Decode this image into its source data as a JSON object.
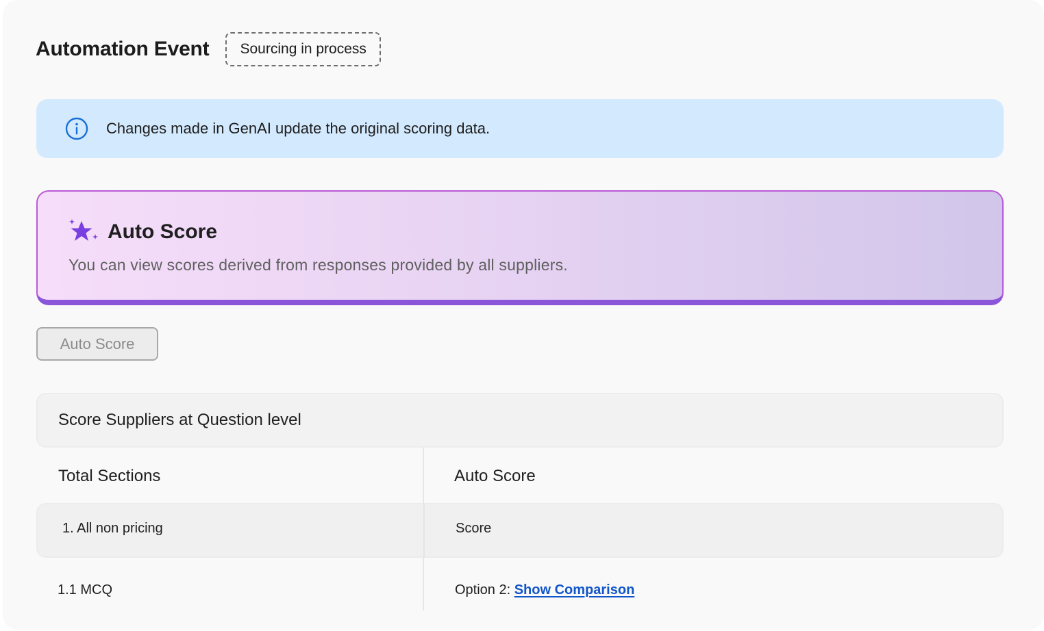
{
  "header": {
    "title": "Automation Event",
    "status": "Sourcing in process"
  },
  "info_banner": {
    "icon": "info-icon",
    "text": "Changes made in GenAI update the original scoring data."
  },
  "auto_score_card": {
    "icon": "sparkle-icon",
    "title": "Auto Score",
    "description": "You can view scores derived from responses provided by all suppliers."
  },
  "auto_score_button": {
    "label": "Auto Score"
  },
  "score_table": {
    "header": "Score Suppliers at Question level",
    "columns": [
      "Total Sections",
      "Auto Score"
    ],
    "section_row": {
      "name": "1. All non pricing",
      "value": "Score"
    },
    "question_row": {
      "name": "1.1 MCQ",
      "value_prefix": "Option 2:",
      "link_label": "Show Comparison"
    }
  },
  "colors": {
    "info_bg": "#d3e9fd",
    "info_icon": "#1a6fd6",
    "card_border": "#b95ad6",
    "card_accent": "#8a55d9",
    "sparkle": "#7a3fe0",
    "link": "#1156c9"
  }
}
